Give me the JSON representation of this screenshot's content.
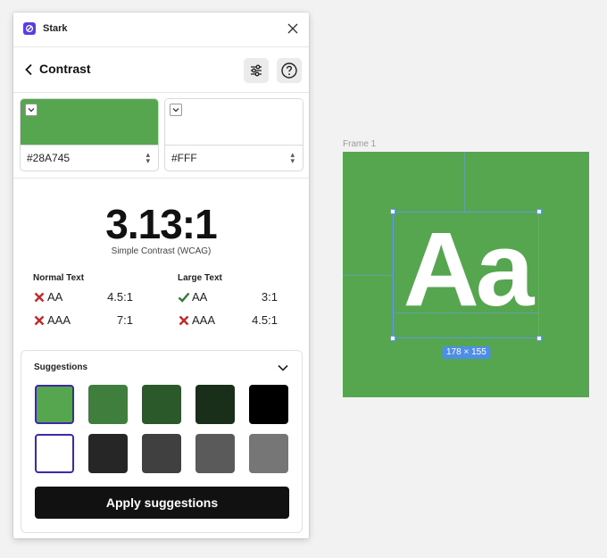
{
  "app": {
    "title": "Stark",
    "logo_icon": "stark-logo-icon",
    "close_icon": "close-icon"
  },
  "header": {
    "title": "Contrast",
    "back_icon": "chevron-left-icon",
    "filters_icon": "sliders-icon",
    "help_icon": "help-circle-icon"
  },
  "colors": {
    "foreground": {
      "hex": "#28A745",
      "swatch": "#56A64F"
    },
    "background": {
      "hex": "#FFF",
      "swatch": "#FFFFFF"
    }
  },
  "result": {
    "ratio": "3.13:1",
    "method": "Simple Contrast (WCAG)"
  },
  "grades": {
    "normal": {
      "title": "Normal Text",
      "rows": [
        {
          "level": "AA",
          "ratio": "4.5:1",
          "pass": false
        },
        {
          "level": "AAA",
          "ratio": "7:1",
          "pass": false
        }
      ]
    },
    "large": {
      "title": "Large Text",
      "rows": [
        {
          "level": "AA",
          "ratio": "3:1",
          "pass": true
        },
        {
          "level": "AAA",
          "ratio": "4.5:1",
          "pass": false
        }
      ]
    }
  },
  "suggestions": {
    "title": "Suggestions",
    "toggle_icon": "chevron-down-icon",
    "foreground_row": [
      "#56A64F",
      "#3F7E3C",
      "#2B592A",
      "#192F19",
      "#000000"
    ],
    "background_row": [
      "#FFFFFF",
      "#262626",
      "#404040",
      "#5A5A5A",
      "#767676"
    ],
    "apply_label": "Apply suggestions"
  },
  "canvas": {
    "frame_label": "Frame 1",
    "frame_color": "#56A64F",
    "sample_text": "Aa",
    "dimensions": "178 × 155"
  },
  "status_colors": {
    "pass": "#2E7D32",
    "fail": "#C62828",
    "selection": "#3D2AA8"
  }
}
